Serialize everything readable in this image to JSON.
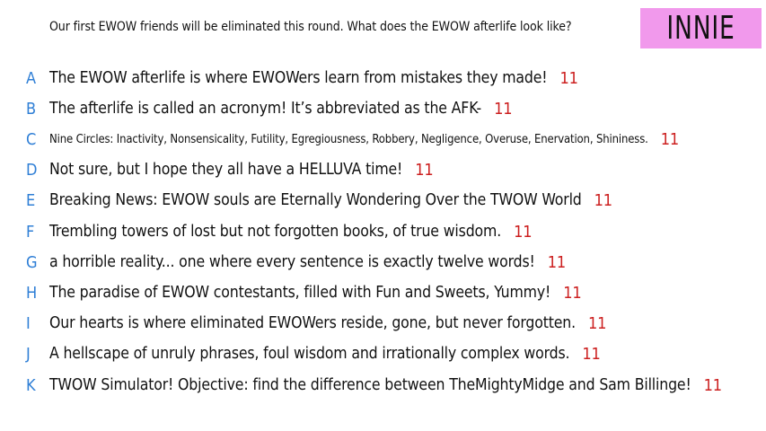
{
  "prompt": "Our first EWOW friends will be eliminated this round. What does the EWOW afterlife look like?",
  "contestant_name": "INNIE",
  "colors": {
    "letter": "#2f7fd6",
    "count": "#cc1f1f",
    "name_box": "#f199ec"
  },
  "responses": [
    {
      "letter": "A",
      "text": "The EWOW afterlife is where EWOWers learn from mistakes they made!",
      "count": "11"
    },
    {
      "letter": "B",
      "text": "The afterlife is called an acronym! It’s abbreviated as the AFK-",
      "count": "11"
    },
    {
      "letter": "C",
      "text": "Nine Circles: Inactivity, Nonsensicality, Futility, Egregiousness, Robbery, Negligence, Overuse, Enervation, Shininess.",
      "count": "11"
    },
    {
      "letter": "D",
      "text": "Not sure, but I hope they all have a HELLUVA time!",
      "count": "11"
    },
    {
      "letter": "E",
      "text": "Breaking News: EWOW souls are Eternally Wondering Over the TWOW World",
      "count": "11"
    },
    {
      "letter": "F",
      "text": "Trembling towers of lost but not forgotten books, of true wisdom.",
      "count": "11"
    },
    {
      "letter": "G",
      "text": "a horrible reality... one where every sentence is exactly twelve words!",
      "count": "11"
    },
    {
      "letter": "H",
      "text": "The paradise of EWOW contestants, filled with Fun and Sweets, Yummy!",
      "count": "11"
    },
    {
      "letter": "I",
      "text": "Our hearts is where eliminated EWOWers reside, gone, but never forgotten.",
      "count": "11"
    },
    {
      "letter": "J",
      "text": "A hellscape of unruly phrases, foul wisdom and irrationally complex words.",
      "count": "11"
    },
    {
      "letter": "K",
      "text": "TWOW Simulator! Objective: find the difference between TheMightyMidge and Sam Billinge!",
      "count": "11"
    }
  ]
}
